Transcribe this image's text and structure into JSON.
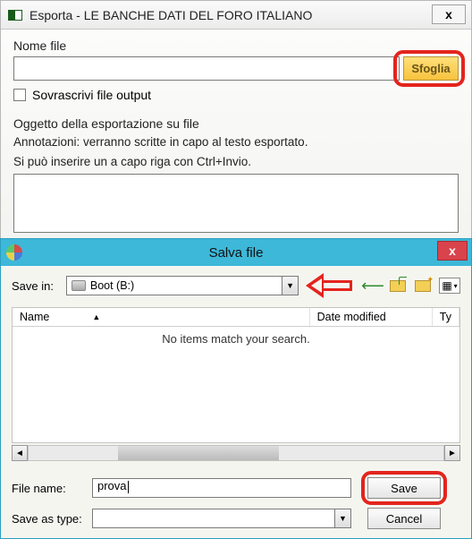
{
  "win1": {
    "title": "Esporta - LE BANCHE DATI DEL FORO ITALIANO",
    "close": "x",
    "nomefile_label": "Nome file",
    "nomefile_value": "",
    "sfoglia": "Sfoglia",
    "sovrascrivi": "Sovrascrivi file output",
    "oggetto_label": "Oggetto della esportazione su file",
    "annot1": "Annotazioni: verranno scritte in capo al testo esportato.",
    "annot2": "Si può inserire un a capo riga con Ctrl+Invio.",
    "oggetto_value": ""
  },
  "win2": {
    "title": "Salva file",
    "close": "x",
    "savein_label": "Save in:",
    "savein_value": "Boot (B:)",
    "col_name": "Name",
    "col_date": "Date modified",
    "col_ty": "Ty",
    "empty_msg": "No items match your search.",
    "filename_label": "File name:",
    "filename_value": "prova",
    "saveastype_label": "Save as type:",
    "saveastype_value": "",
    "save_btn": "Save",
    "cancel_btn": "Cancel"
  }
}
